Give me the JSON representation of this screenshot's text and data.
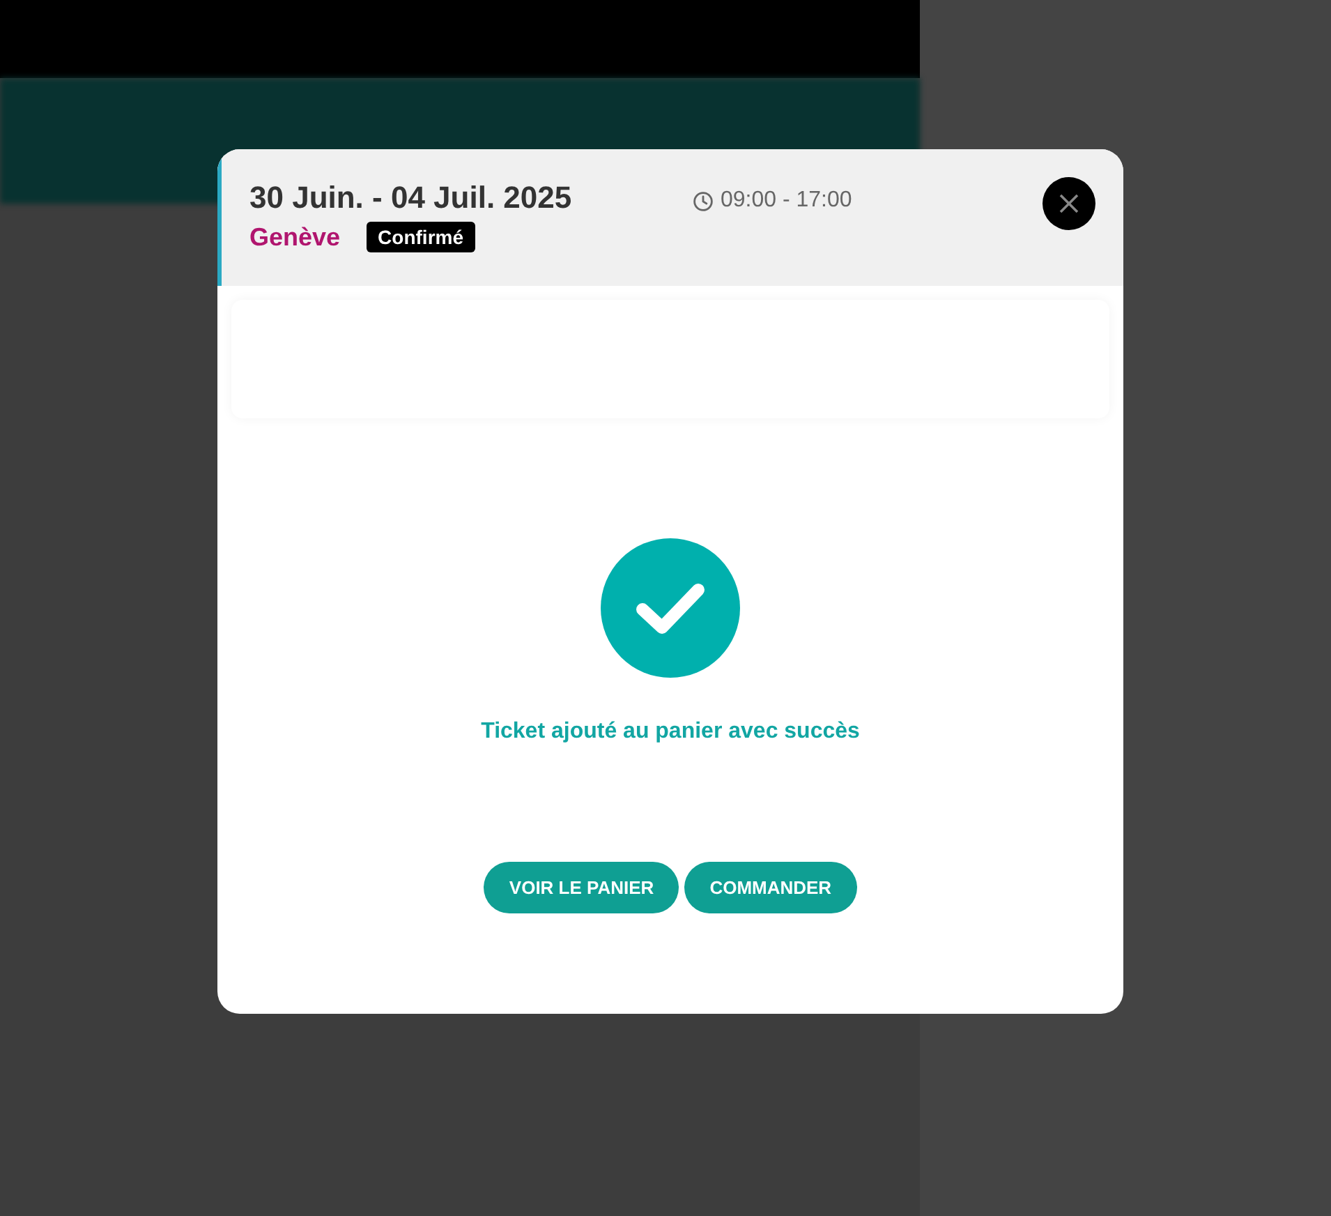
{
  "modal": {
    "dates": "30 Juin. - 04 Juil. 2025",
    "time": "09:00 - 17:00",
    "city": "Genève",
    "status": "Confirmé",
    "message": "Ticket ajouté au panier avec succès",
    "buttons": [
      "VOIR LE PANIER",
      "COMMANDER"
    ]
  }
}
